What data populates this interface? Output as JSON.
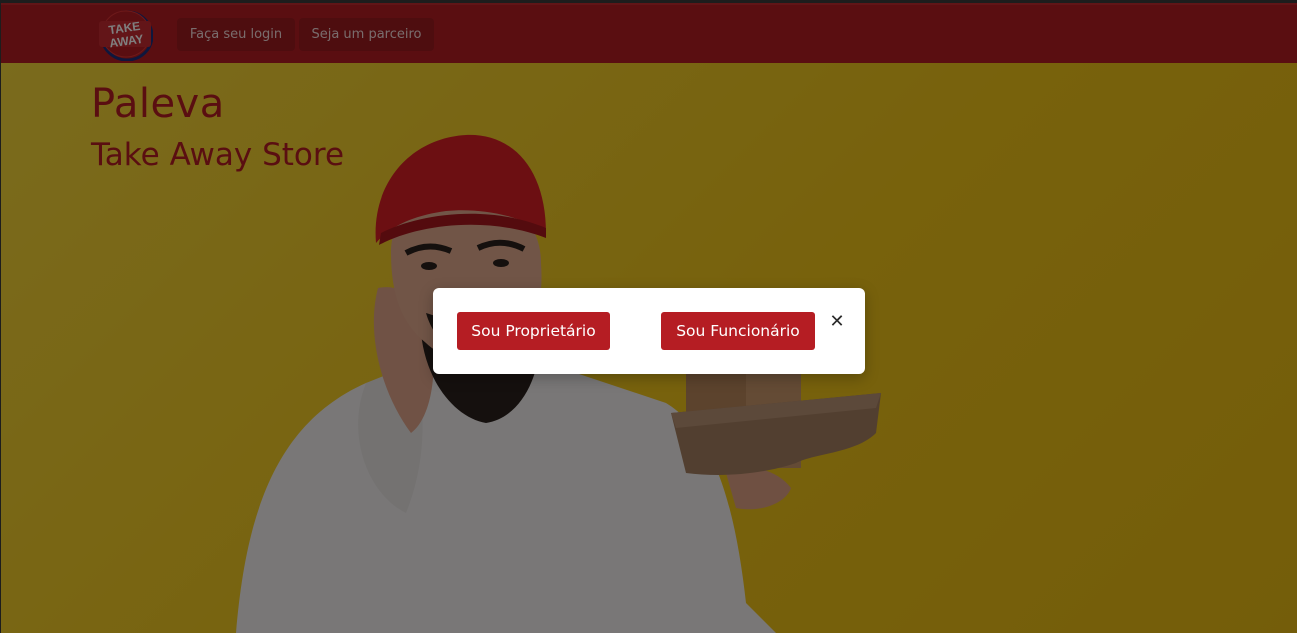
{
  "navbar": {
    "logo_text_1": "TAKE",
    "logo_text_2": "AWAY",
    "login_label": "Faça seu login",
    "partner_label": "Seja um parceiro"
  },
  "hero": {
    "title": "Paleva",
    "subtitle": "Take Away Store"
  },
  "modal": {
    "owner_label": "Sou Proprietário",
    "employee_label": "Sou Funcionário",
    "close_glyph": "✕"
  },
  "colors": {
    "brand_red": "#b51d23",
    "hero_yellow": "#f0c419",
    "modal_bg": "#ffffff"
  }
}
